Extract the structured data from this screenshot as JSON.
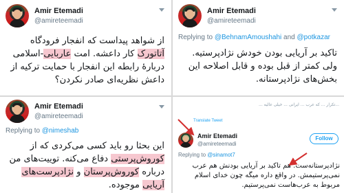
{
  "tweets": [
    {
      "position": "top-left",
      "name": "Amir Etemadi",
      "handle": "@amireteemadi",
      "text_parts": [
        {
          "t": "از شواهد پیداست که انفجار فرودگاه ",
          "hl": false
        },
        {
          "t": "آتاتورک",
          "hl": true
        },
        {
          "t": " کار داعشه. امت ",
          "hl": false
        },
        {
          "t": "عاربایی",
          "hl": true
        },
        {
          "t": "-اسلامی دربارهٔ رابطه این انفجار با حمایت ترکیه از داعش نظریه‌ای صادر نکردن؟",
          "hl": false
        }
      ]
    },
    {
      "position": "top-right",
      "name": "Amir Etemadi",
      "handle": "@amireteemadi",
      "reply_prefix": "Replying to",
      "reply_mention_1": "@BehnamAmoushahi",
      "reply_and": "and",
      "reply_mention_2": "@potkazar",
      "text": "تاکید بر آریایی بودن خودش نژادپرستیه. ولی کمتر از قبل بوده و قابل اصلاحه این بخش‌های نژادپرستانه."
    },
    {
      "position": "bottom-left",
      "name": "Amir Etemadi",
      "handle": "@amireteemadi",
      "reply_prefix": "Replying to",
      "reply_mention_1": "@nimeshab",
      "text_parts": [
        {
          "t": "این بحثا رو باید کسی می‌کردی که از ",
          "hl": false
        },
        {
          "t": "کوروش‌پرستی",
          "hl": true
        },
        {
          "t": " دفاع می‌کنه. توییت‌های من درباره ",
          "hl": false
        },
        {
          "t": "کوروش‌پرستان",
          "hl": true
        },
        {
          "t": " و ",
          "hl": false
        },
        {
          "t": "نژادپرست‌های آریایی",
          "hl": true
        },
        {
          "t": " موجوده.",
          "hl": false
        }
      ]
    },
    {
      "position": "bottom-right",
      "name": "Amir Etemadi",
      "handle": "@amireteemadi",
      "reply_prefix": "Replying to",
      "reply_mention_1": "@sinamot7",
      "follow_label": "Follow",
      "translate_label": "Translate Tweet",
      "faded_text": "...تکرار ... که عرب ... ایرانی ... خیلی عالیه ...",
      "text_parts": [
        {
          "t": "نژادپرستانه‌ست",
          "hl": false
        },
        {
          "t": ". هم تاکید بر آریایی بودنش هم عرب نمی‌پرستیمش. در واقع داره میگه چون خدای اسلام مربوط به عرب‌هاست نمی‌پرستیم.",
          "hl": false
        }
      ]
    }
  ],
  "colors": {
    "highlight": "#f6c7cf",
    "mention": "#1b95e0",
    "arrow": "#d32f2f"
  }
}
